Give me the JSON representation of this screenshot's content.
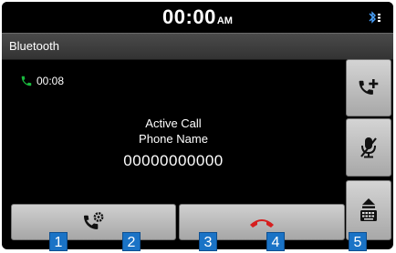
{
  "status_bar": {
    "time": "00:00",
    "ampm": "AM",
    "icons": [
      "bluetooth-icon",
      "signal-icon"
    ]
  },
  "header": {
    "title": "Bluetooth"
  },
  "call": {
    "duration": "00:08",
    "status": "Active Call",
    "name": "Phone Name",
    "number": "00000000000"
  },
  "side_buttons": [
    {
      "icon": "add-call-icon"
    },
    {
      "icon": "microphone-mute-icon"
    },
    {
      "icon": "keypad-icon"
    }
  ],
  "bottom_buttons": [
    {
      "icon": "call-settings-icon"
    },
    {
      "icon": "end-call-icon"
    }
  ],
  "callouts": [
    "1",
    "2",
    "3",
    "4",
    "5"
  ],
  "colors": {
    "call_green": "#19b83d",
    "end_call_red": "#d61f1f",
    "callout_blue": "#1a73c6"
  }
}
